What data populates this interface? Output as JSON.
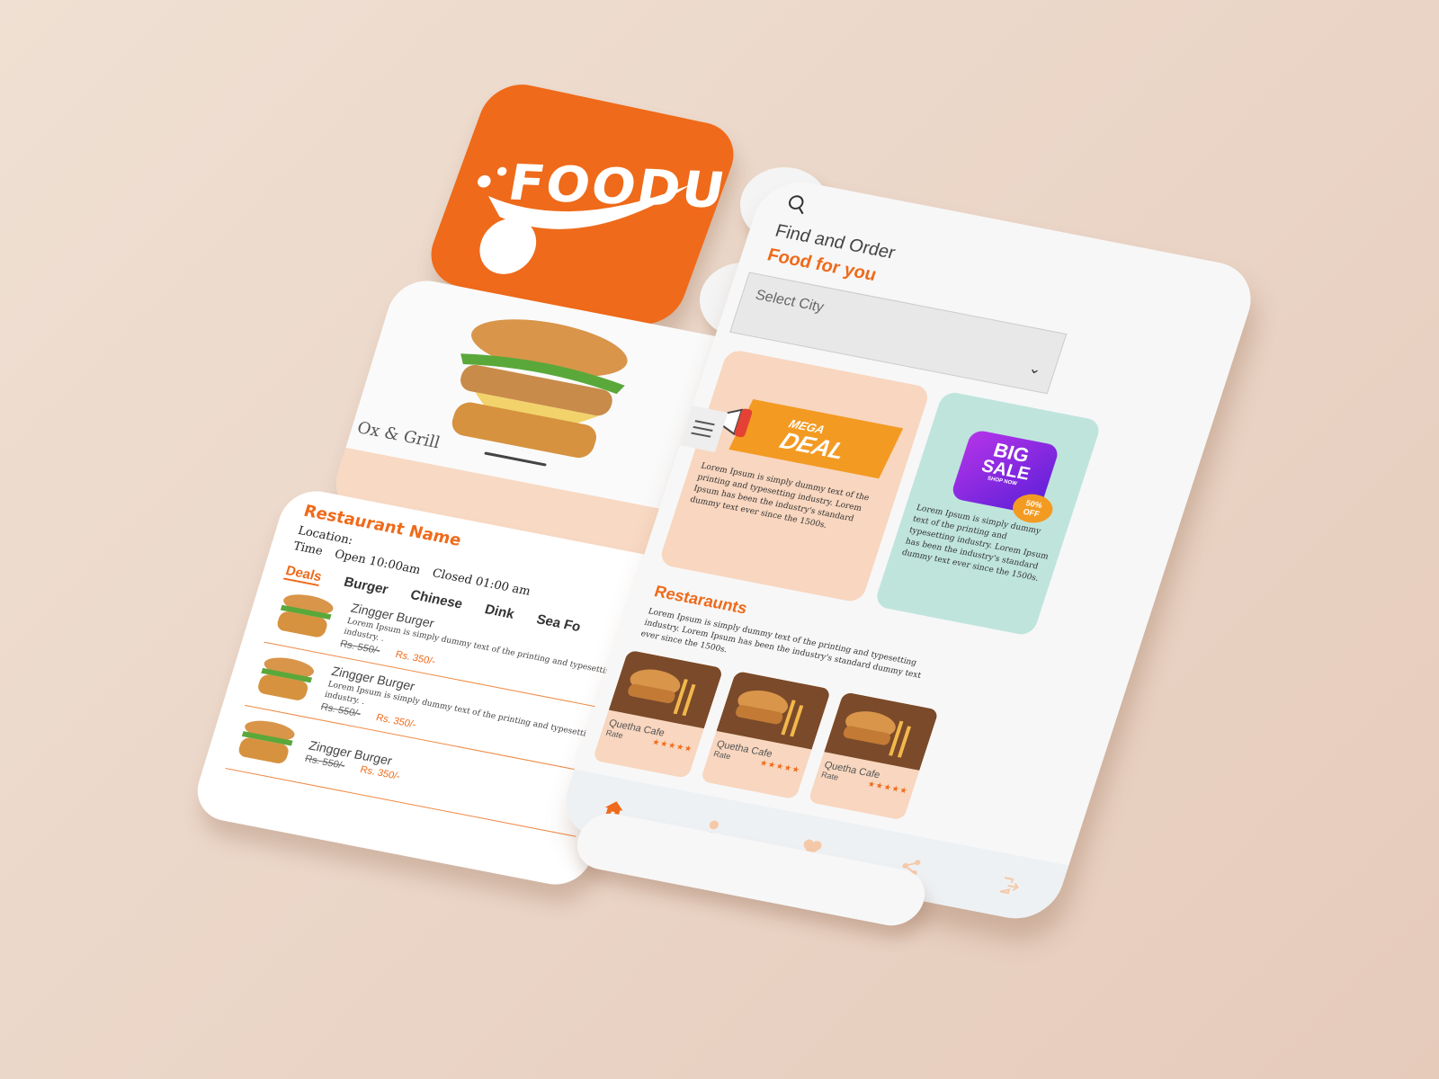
{
  "app_icon": {
    "logo_text": "FOODU",
    "bg_color": "#ef6a1a"
  },
  "floating_buttons": {
    "map": "map-pin-icon",
    "call": "phone-call-icon"
  },
  "burger_card": {
    "title": "Ox & Grill"
  },
  "menu_card": {
    "restaurant_name": "Restaurant Name",
    "location_label": "Location:",
    "time_label": "Time",
    "open_time": "Open 10:00am",
    "close_time": "Closed 01:00 am",
    "tabs": [
      "Deals",
      "Burger",
      "Chinese",
      "Dink",
      "Sea Fo"
    ],
    "items": [
      {
        "name": "Zingger Burger",
        "desc": "Lorem Ipsum is simply dummy text of the printing and typesetting industry. .",
        "old_price": "Rs. 550/-",
        "new_price": "Rs. 350/-"
      },
      {
        "name": "Zingger Burger",
        "desc": "Lorem Ipsum is simply dummy text of the printing and typesetting industry. .",
        "old_price": "Rs. 550/-",
        "new_price": "Rs. 350/-"
      },
      {
        "name": "Zingger Burger",
        "desc": "",
        "old_price": "Rs. 550/-",
        "new_price": "Rs. 350/-"
      }
    ]
  },
  "phone": {
    "heading_line1": "Find and Order",
    "heading_line2": "Food for you",
    "city_select_placeholder": "Select City",
    "promo_deal": {
      "mega": "MEGA",
      "deal": "DEAL",
      "text": "Lorem Ipsum is simply dummy text of the printing and typesetting industry. Lorem Ipsum has been the industry's standard dummy text ever since the 1500s."
    },
    "promo_sale": {
      "big": "BIG",
      "sale": "SALE",
      "shop": "SHOP NOW",
      "off_pct": "50%",
      "off_label": "OFF",
      "text": "Lorem Ipsum is simply dummy text of the printing and typesetting industry. Lorem Ipsum has been the industry's standard dummy text ever since the 1500s."
    },
    "restaurants_title": "Restaraunts",
    "restaurants_desc": "Lorem Ipsum is simply dummy text of the printing and typesetting industry. Lorem Ipsum has been the industry's standard dummy text ever since the 1500s.",
    "restaurant_cards": [
      {
        "name": "Quetha Cafe",
        "rate_label": "Rate",
        "stars": "★★★★★"
      },
      {
        "name": "Quetha Cafe",
        "rate_label": "Rate",
        "stars": "★★★★★"
      },
      {
        "name": "Quetha Cafe",
        "rate_label": "Rate",
        "stars": "★★★★★"
      }
    ],
    "bottom_nav": [
      "home-icon",
      "profile-icon",
      "heart-icon",
      "share-icon",
      "logout-icon"
    ]
  },
  "colors": {
    "accent": "#ef6a1a",
    "peach": "#f8d6bf",
    "teal": "#bfe4dc"
  }
}
